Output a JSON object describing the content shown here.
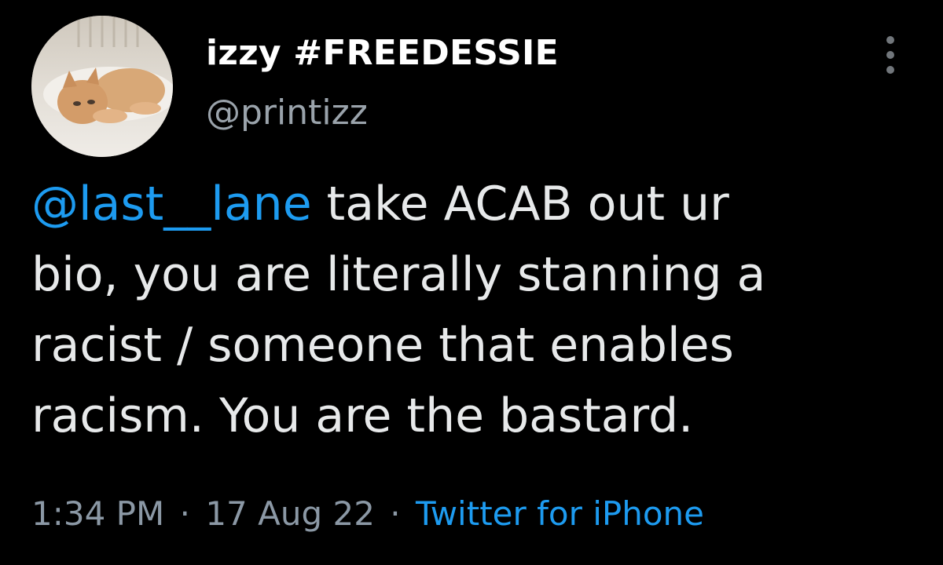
{
  "author": {
    "display_name": "izzy #FREEDESSIE",
    "handle": "@printizz",
    "avatar": "cat-photo-avatar"
  },
  "menu": {
    "icon": "more-options-icon"
  },
  "tweet": {
    "mention": "@last__lane",
    "line1_rest": " take ACAB out ur",
    "line2": "bio, you are literally stanning a",
    "line3": "racist / someone that enables",
    "line4": "racism. You are the bastard."
  },
  "meta": {
    "time": "1:34 PM",
    "separator": "·",
    "date": "17 Aug 22",
    "source": "Twitter for iPhone"
  },
  "colors": {
    "background": "#000000",
    "accent": "#1d9bf0",
    "text": "#e7e9ea",
    "secondary": "#8b98a5"
  }
}
